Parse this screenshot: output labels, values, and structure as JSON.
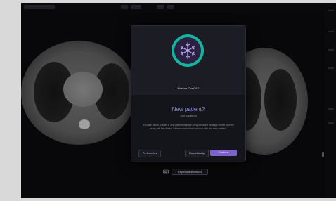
{
  "modal": {
    "logo_label": "Kheiron OneCAD",
    "title": "New patient?",
    "subtitle": "Add a patient",
    "body": "You are about to start a new patient session. Any unsaved findings on the current study will be closed. Please confirm to continue with the new patient.",
    "buttons": {
      "left": "Preferences",
      "middle": "Cancel study",
      "primary": "Continue"
    }
  },
  "footer": {
    "label": "Keyboard shortcuts"
  },
  "icons": [
    "snowflake-logo-icon",
    "keyboard-icon"
  ],
  "colors": {
    "accent": "#7c63c8",
    "logo_ring": "#14b4a0",
    "title": "#8c8ce0"
  }
}
